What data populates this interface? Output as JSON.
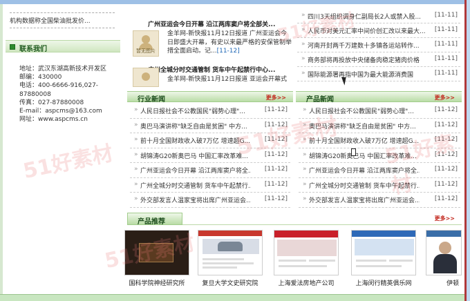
{
  "left": {
    "top_link": "机构数据称全国柴油批发价...",
    "contact_title": "联系我们",
    "contact_lines": [
      "地址：武汉东湖高新技术开发区",
      "邮编：430000",
      "电话：400-6666-916,027-",
      "87880008",
      "传真：027-87880008",
      "E-mail：aspcms@163.com",
      "网址：www.aspcms.cn"
    ]
  },
  "mid_news": [
    {
      "title": "广州亚运会今日开幕 沿江两库窦户将全部关...",
      "thumb_label": "暂无图片",
      "desc_1": "金羊网-新快报11月12日报道  广州亚运会今",
      "desc_2": "日即盛大开幕，有史以来最严格的安保管制举",
      "desc_3": "措全面启动。记...",
      "desc_more": "[11-12]"
    },
    {
      "title": "广州全城分时交通管制 货车中午起禁行中心...",
      "thumb_label": "暂无图片",
      "desc_1": "金羊网-新快报11月12日报道  亚运会开幕式",
      "desc_2": "",
      "desc_3": "",
      "desc_more": ""
    }
  ],
  "right_top_list": [
    {
      "text": "四川3天组织调身仁副局长2人或禁入股...",
      "date": "[11-11]"
    },
    {
      "text": "人民币对美元汇率中间价创汇改以来最大...",
      "date": "[11-11]"
    },
    {
      "text": "河南开封两千万建数十多镇各运站转作...",
      "date": "[11-11]"
    },
    {
      "text": "商务部将再投放中央储备肉稳定猪肉价格",
      "date": "[11-11]"
    },
    {
      "text": "国际能源署再指中国为最大能源消费国",
      "date": "[11-11]"
    }
  ],
  "industry": {
    "title": "行业新闻",
    "more": "更多>>",
    "items": [
      {
        "text": "人民日报社会不公教国民\"弱势心理\"...",
        "date": "[11-12]"
      },
      {
        "text": "奥巴马演讲称\"缺乏自由是贫困\" 中方...",
        "date": "[11-12]"
      },
      {
        "text": "前十月全国财政收入破7万亿 增速超G...",
        "date": "[11-12]"
      },
      {
        "text": "胡锦涛G20新奥巴马 中国汇率改革难...",
        "date": "[11-12]"
      },
      {
        "text": "广州亚运会今日开幕 沿江两库窦户将全...",
        "date": "[11-12]"
      },
      {
        "text": "广州全城分时交通管制 货车中午起禁行...",
        "date": "[11-12]"
      },
      {
        "text": "外交部发言人温家宝将出席广州亚运会...",
        "date": "[11-12]"
      }
    ]
  },
  "products_news": {
    "title": "产品新闻",
    "more": "更多>>",
    "items": [
      {
        "text": "人民日报社会不公教国民\"弱势心理\"...",
        "date": "[11-12]"
      },
      {
        "text": "奥巴马演讲称\"缺乏自由是贫困\" 中方...",
        "date": "[11-12]"
      },
      {
        "text": "前十月全国财政收入破7万亿 增速超G...",
        "date": "[11-12]"
      },
      {
        "text": "胡锦涛G20新奥巴马 中国汇率改革难...",
        "date": "[11-12]"
      },
      {
        "text": "广州亚运会今日开幕 沿江两库窦户将全...",
        "date": "[11-12]"
      },
      {
        "text": "广州全城分时交通管制 货车中午起禁行...",
        "date": "[11-12]"
      },
      {
        "text": "外交部发言人温家宝将出席广州亚运会...",
        "date": "[11-12]"
      }
    ]
  },
  "recommend": {
    "title": "产品推荐",
    "more": "更多>>",
    "items": [
      {
        "caption": "国科学院神经研究所"
      },
      {
        "caption": "复旦大学文史研究院"
      },
      {
        "caption": "上海爱法房地产公司"
      },
      {
        "caption": "上海闵行精英俱乐网"
      },
      {
        "caption": "伊顿"
      }
    ]
  },
  "watermark": "51好素材",
  "bullet": "»"
}
